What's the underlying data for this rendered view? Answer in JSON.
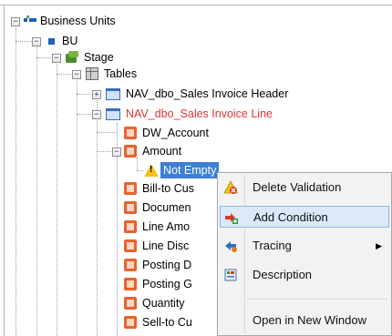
{
  "tree": {
    "root": "Business Units",
    "bu": "BU",
    "stage": "Stage",
    "tables": "Tables",
    "table_header": "NAV_dbo_Sales Invoice Header",
    "table_line": "NAV_dbo_Sales Invoice Line",
    "col_dw_account": "DW_Account",
    "col_amount": "Amount",
    "validation": "Not Empty",
    "col_bill_to": "Bill-to Cus",
    "col_document": "Documen",
    "col_line_amount": "Line Amo",
    "col_line_disc": "Line Disc",
    "col_posting_d": "Posting D",
    "col_posting_g": "Posting G",
    "col_quantity": "Quantity",
    "col_sell_to": "Sell-to Cu",
    "expand_minus": "−",
    "expand_plus": "+",
    "warn_glyph": "!"
  },
  "context_menu": {
    "items": [
      {
        "label": "Delete Validation",
        "icon": "delete-validation-icon"
      },
      {
        "label": "Add Condition",
        "icon": "add-condition-icon"
      },
      {
        "label": "Tracing",
        "icon": "tracing-icon"
      },
      {
        "label": "Description",
        "icon": "description-icon"
      },
      {
        "label": "Open in New Window",
        "icon": ""
      }
    ],
    "submenu_arrow": "▶"
  },
  "colors": {
    "selection": "#3e7fd6",
    "red_text": "#e03434",
    "hover": "#dbe9f8"
  }
}
